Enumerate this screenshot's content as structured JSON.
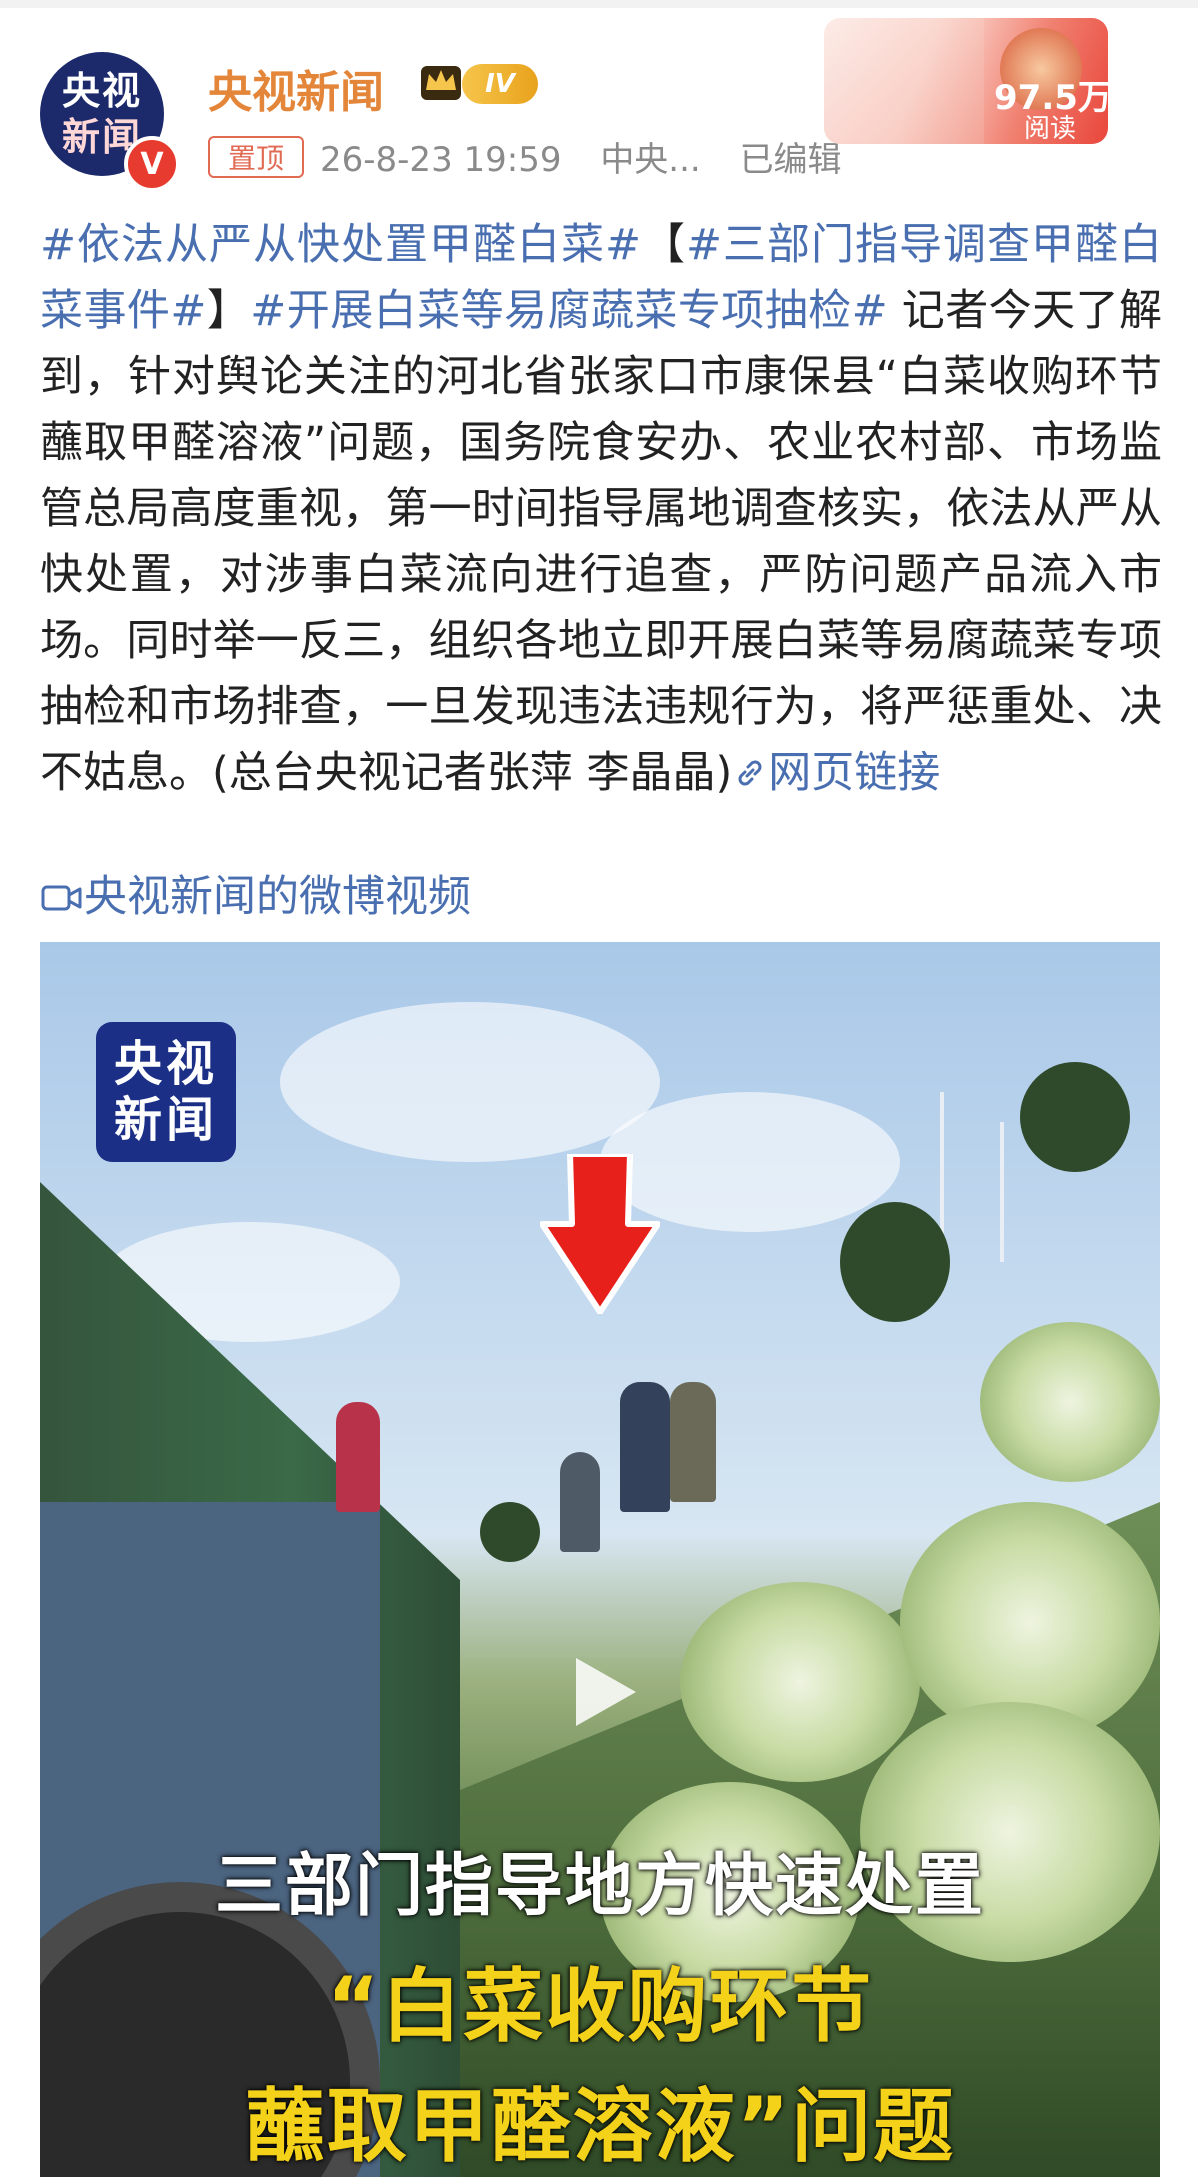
{
  "post": {
    "author": "央视新闻",
    "avatar_line1": "央视",
    "avatar_line2": "新闻",
    "verified_mark": "V",
    "level": "IV",
    "pinned_label": "置顶",
    "time": "26-8-23 19:59",
    "source": "中央...",
    "edited": "已编辑",
    "read_count": "97.5万",
    "read_label": "阅读"
  },
  "content": {
    "tag1": "#依法从严从快处置甲醛白菜#",
    "bracket_open": "【",
    "tag2": "#三部门指导调查甲醛白菜事件#",
    "bracket_close": "】",
    "tag3": "#开展白菜等易腐蔬菜专项抽检#",
    "body": " 记者今天了解到，针对舆论关注的河北省张家口市康保县“白菜收购环节蘸取甲醛溶液”问题，国务院食安办、农业农村部、市场监管总局高度重视，第一时间指导属地调查核实，依法从严从快处置，对涉事白菜流向进行追查，严防问题产品流入市场。同时举一反三，组织各地立即开展白菜等易腐蔬菜专项抽检和市场排查，一旦发现违法违规行为，将严惩重处、决不姑息。(总台央视记者张萍 李晶晶)",
    "web_link": "网页链接",
    "video_link": "央视新闻的微博视频"
  },
  "video": {
    "logo_line1": "央视",
    "logo_line2": "新闻",
    "caption_line1": "三部门指导地方快速处置",
    "caption_line2": "“白菜收购环节",
    "caption_line3": "蘸取甲醛溶液”问题"
  },
  "icons": [
    "verified-icon",
    "crown-icon",
    "link-icon",
    "video-camera-icon",
    "play-icon",
    "red-arrow-icon"
  ],
  "colors": {
    "author": "#e4863a",
    "topic_link": "#4a6fb0",
    "pinned": "#e06a52",
    "meta": "#8a8a8a",
    "caption_yellow": "#f5d21a",
    "arrow_red": "#e8201c"
  }
}
